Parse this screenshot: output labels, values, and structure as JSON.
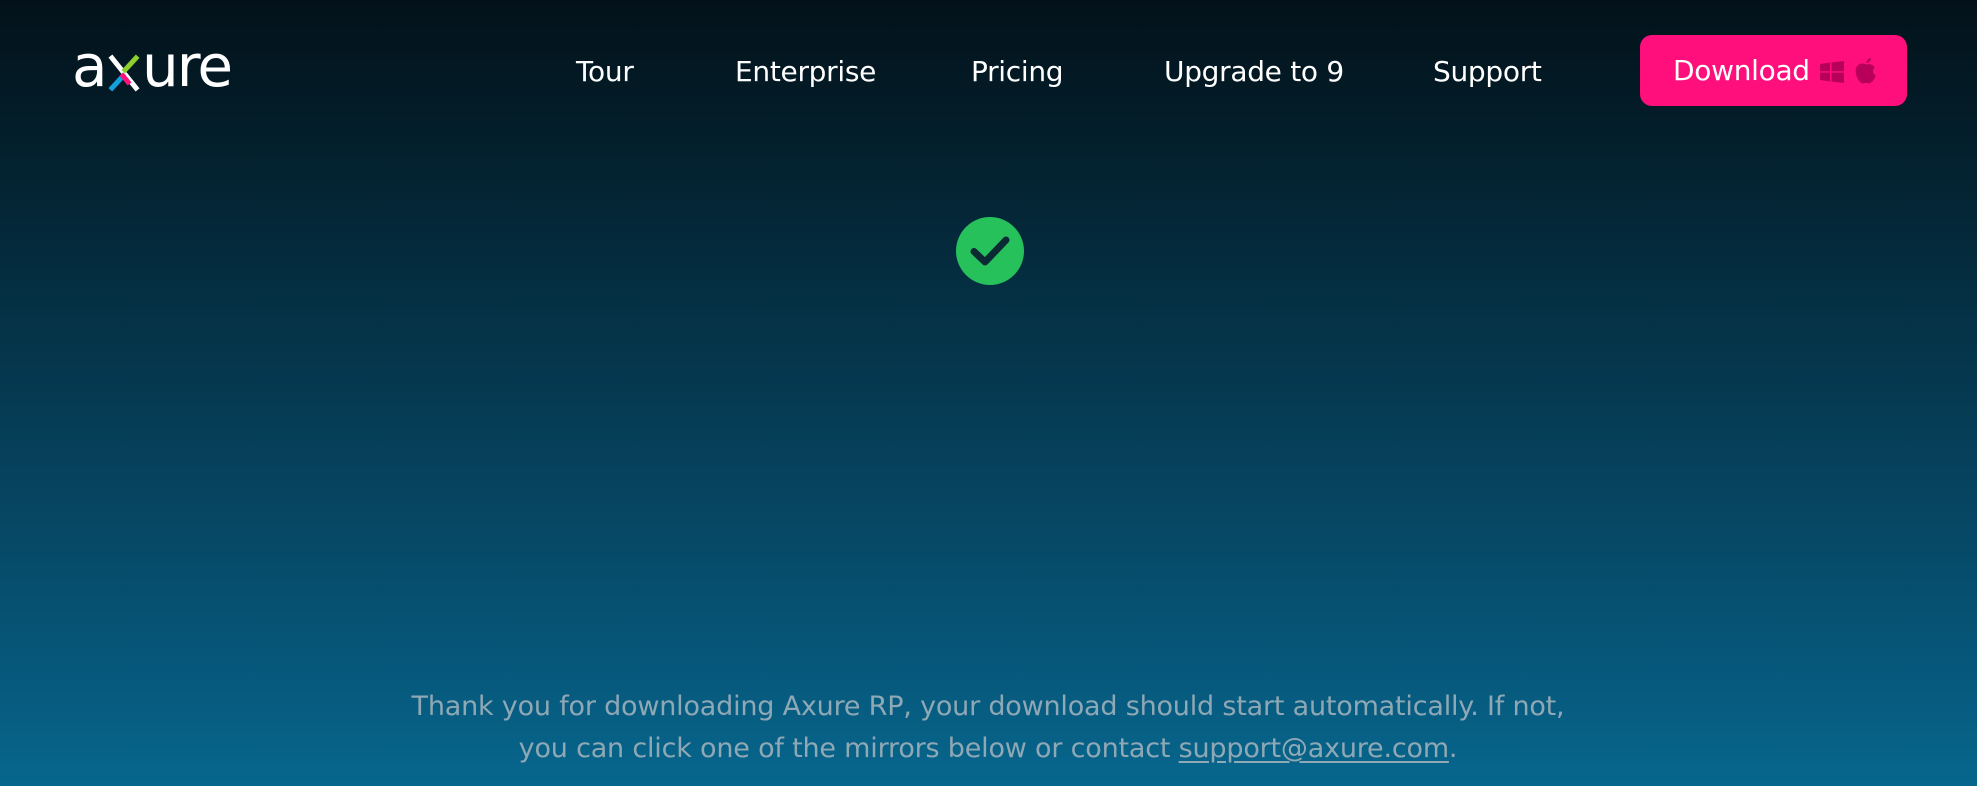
{
  "brand": {
    "logo_text": "axure",
    "accent_colors": {
      "blue": "#13a0dc",
      "pink": "#ff0f7b",
      "green": "#8ccf2e"
    }
  },
  "nav": {
    "items": [
      {
        "label": "Tour"
      },
      {
        "label": "Enterprise"
      },
      {
        "label": "Pricing"
      },
      {
        "label": "Upgrade to 9"
      },
      {
        "label": "Support"
      }
    ]
  },
  "download_button": {
    "label": "Download",
    "icons": [
      "windows-icon",
      "apple-icon"
    ],
    "color": "#ff0f7b"
  },
  "status": {
    "icon": "check-circle-icon",
    "color": "#27c15c"
  },
  "message": {
    "line1": "Thank you for downloading Axure RP, your download should start automatically. If not,",
    "line2_prefix": "you can click one of the mirrors below or contact ",
    "email": "support@axure.com",
    "line2_suffix": "."
  }
}
